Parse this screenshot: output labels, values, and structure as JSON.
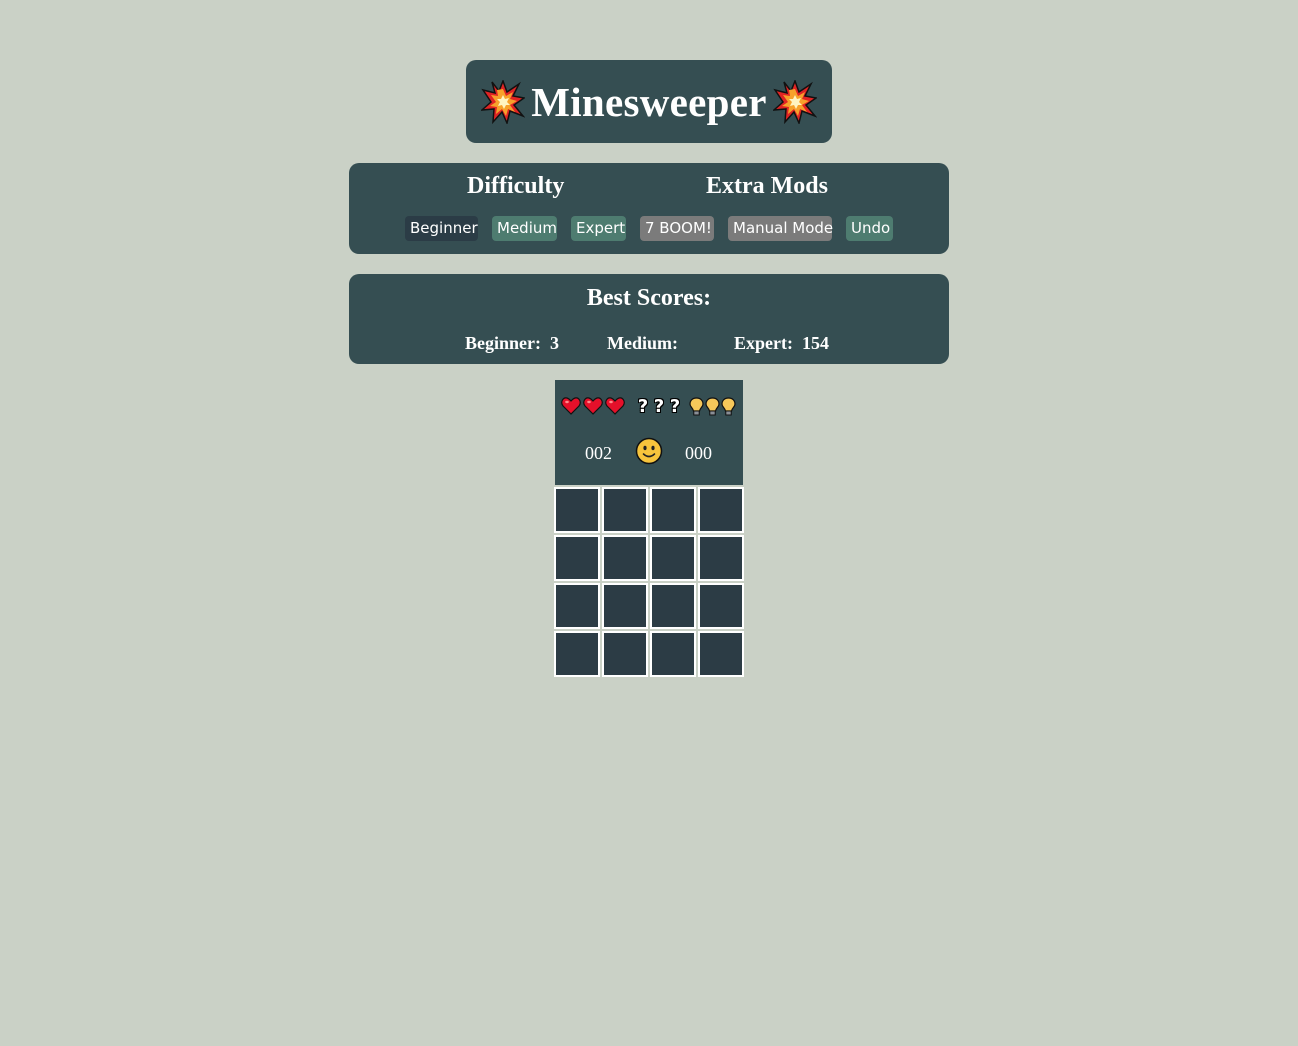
{
  "title": "Minesweeper",
  "controls": {
    "difficulty_heading": "Difficulty",
    "mods_heading": "Extra Mods",
    "buttons": {
      "beginner": "Beginner",
      "medium": "Medium",
      "expert": "Expert",
      "seven_boom": "7 BOOM!",
      "manual_mode": "Manual Mode",
      "undo": "Undo"
    },
    "selected_difficulty": "Beginner"
  },
  "best_scores": {
    "title": "Best Scores:",
    "beginner_label": "Beginner:",
    "beginner_value": "3",
    "medium_label": "Medium:",
    "medium_value": "",
    "expert_label": "Expert:",
    "expert_value": "154"
  },
  "game": {
    "lives": 3,
    "mystery_marks": [
      "?",
      "?",
      "?"
    ],
    "hints": 3,
    "mine_counter": "002",
    "timer": "000",
    "smiley_state": "smiley-face-icon",
    "board_rows": 4,
    "board_cols": 4
  },
  "colors": {
    "background": "#cad1c6",
    "panel": "#354e52",
    "cell": "#2c3c45",
    "button_selected": "#2b3c46",
    "button_green": "#4e7c70",
    "button_gray": "#7b7b7b"
  }
}
